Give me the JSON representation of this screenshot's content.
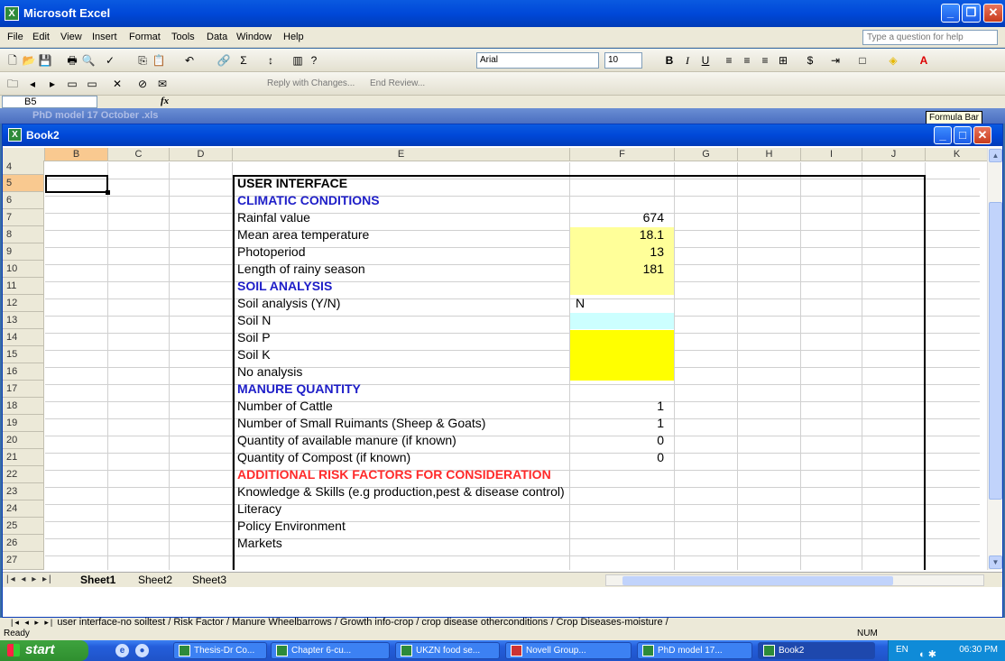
{
  "app": {
    "title": "Microsoft Excel"
  },
  "menu": [
    "File",
    "Edit",
    "View",
    "Insert",
    "Format",
    "Tools",
    "Data",
    "Window",
    "Help"
  ],
  "help_box": {
    "placeholder": "Type a question for help"
  },
  "formatting": {
    "font": "Arial",
    "size": "10"
  },
  "reviewing": {
    "reply": "Reply with Changes...",
    "end": "End Review..."
  },
  "formula_bar": {
    "name_box": "B5",
    "fx": "fx",
    "tooltip": "Formula Bar"
  },
  "background_workbook": {
    "title": "PhD model 17 October .xls"
  },
  "workbook": {
    "title": "Book2"
  },
  "columns": [
    "B",
    "C",
    "D",
    "E",
    "F",
    "G",
    "H",
    "I",
    "J",
    "K"
  ],
  "rows": [
    "4",
    "5",
    "6",
    "7",
    "8",
    "9",
    "10",
    "11",
    "12",
    "13",
    "14",
    "15",
    "16",
    "17",
    "18",
    "19",
    "20",
    "21",
    "22",
    "23",
    "24",
    "25",
    "26",
    "27",
    "28"
  ],
  "cells": {
    "r5": "USER INTERFACE",
    "r6": "CLIMATIC CONDITIONS",
    "r7": "Rainfal value",
    "r8": "Mean area temperature",
    "r9": "Photoperiod",
    "r10": "Length of rainy season",
    "r11": "SOIL ANALYSIS",
    "r12": "Soil analysis (Y/N)",
    "r13": "Soil N",
    "r14": "Soil P",
    "r15": "Soil K",
    "r16": "No analysis",
    "r17": "MANURE QUANTITY",
    "r18": "Number of Cattle",
    "r19": "Number of Small Ruimants (Sheep & Goats)",
    "r20": "Quantity of available manure (if known)",
    "r21": "Quantity of Compost (if known)",
    "r22": "ADDITIONAL RISK FACTORS FOR CONSIDERATION",
    "r23": "Knowledge & Skills (e.g production,pest & disease control)",
    "r24": "Literacy",
    "r25": "Policy Environment",
    "r26": "Markets"
  },
  "values": {
    "f7": "674",
    "f8": "18.1",
    "f9": "13",
    "f10": "181",
    "f12": "N",
    "f18": "1",
    "f19": "1",
    "f20": "0",
    "f21": "0"
  },
  "sheet_tabs": [
    "Sheet1",
    "Sheet2",
    "Sheet3"
  ],
  "parent_tabs": "user interface-no soiltest / Risk Factor / Manure Wheelbarrows / Growth info-crop / crop disease otherconditions / Crop Diseases-moisture /",
  "status": {
    "text": "Ready",
    "indicator": "NUM"
  },
  "taskbar": {
    "start": "start",
    "items": [
      "Thesis-Dr Co...",
      "Chapter 6-cu...",
      "UKZN food se...",
      "Novell Group...",
      "PhD model 17...",
      "Book2"
    ],
    "lang": "EN",
    "clock": "06:30 PM"
  },
  "colors": {
    "yellow_light": "#ffff99",
    "yellow": "#ffff00",
    "cyan_light": "#ccffff",
    "heading_blue": "#1e1ec8",
    "heading_red": "#ff2a2a"
  }
}
